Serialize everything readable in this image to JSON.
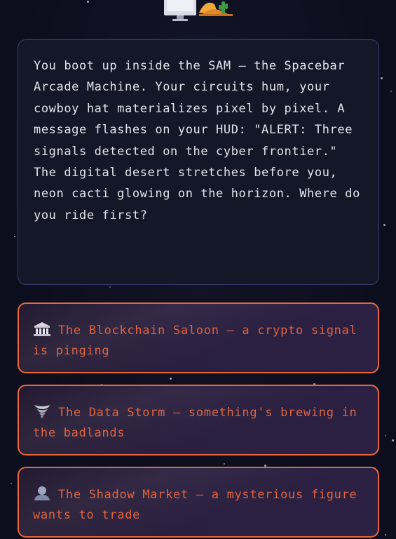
{
  "story": {
    "text": "You boot up inside the SAM — the Spacebar Arcade Machine. Your circuits hum, your cowboy hat materializes pixel by pixel. A message flashes on your HUD: \"ALERT: Three signals detected on the cyber frontier.\" The digital desert stretches before you, neon cacti glowing on the horizon. Where do you ride first?"
  },
  "choices": [
    {
      "icon": "bank-icon",
      "label": "The Blockchain Saloon — a crypto signal is pinging"
    },
    {
      "icon": "tornado-icon",
      "label": "The Data Storm — something's brewing in the badlands"
    },
    {
      "icon": "silhouette-icon",
      "label": "The Shadow Market — a mysterious figure wants to trade"
    }
  ],
  "colors": {
    "background": "#0c0e1d",
    "panel": "#141728",
    "panel_border": "#3a3f6e",
    "choice_border": "#e8663a",
    "choice_text": "#e0643f",
    "story_text": "#e4e4ea"
  }
}
